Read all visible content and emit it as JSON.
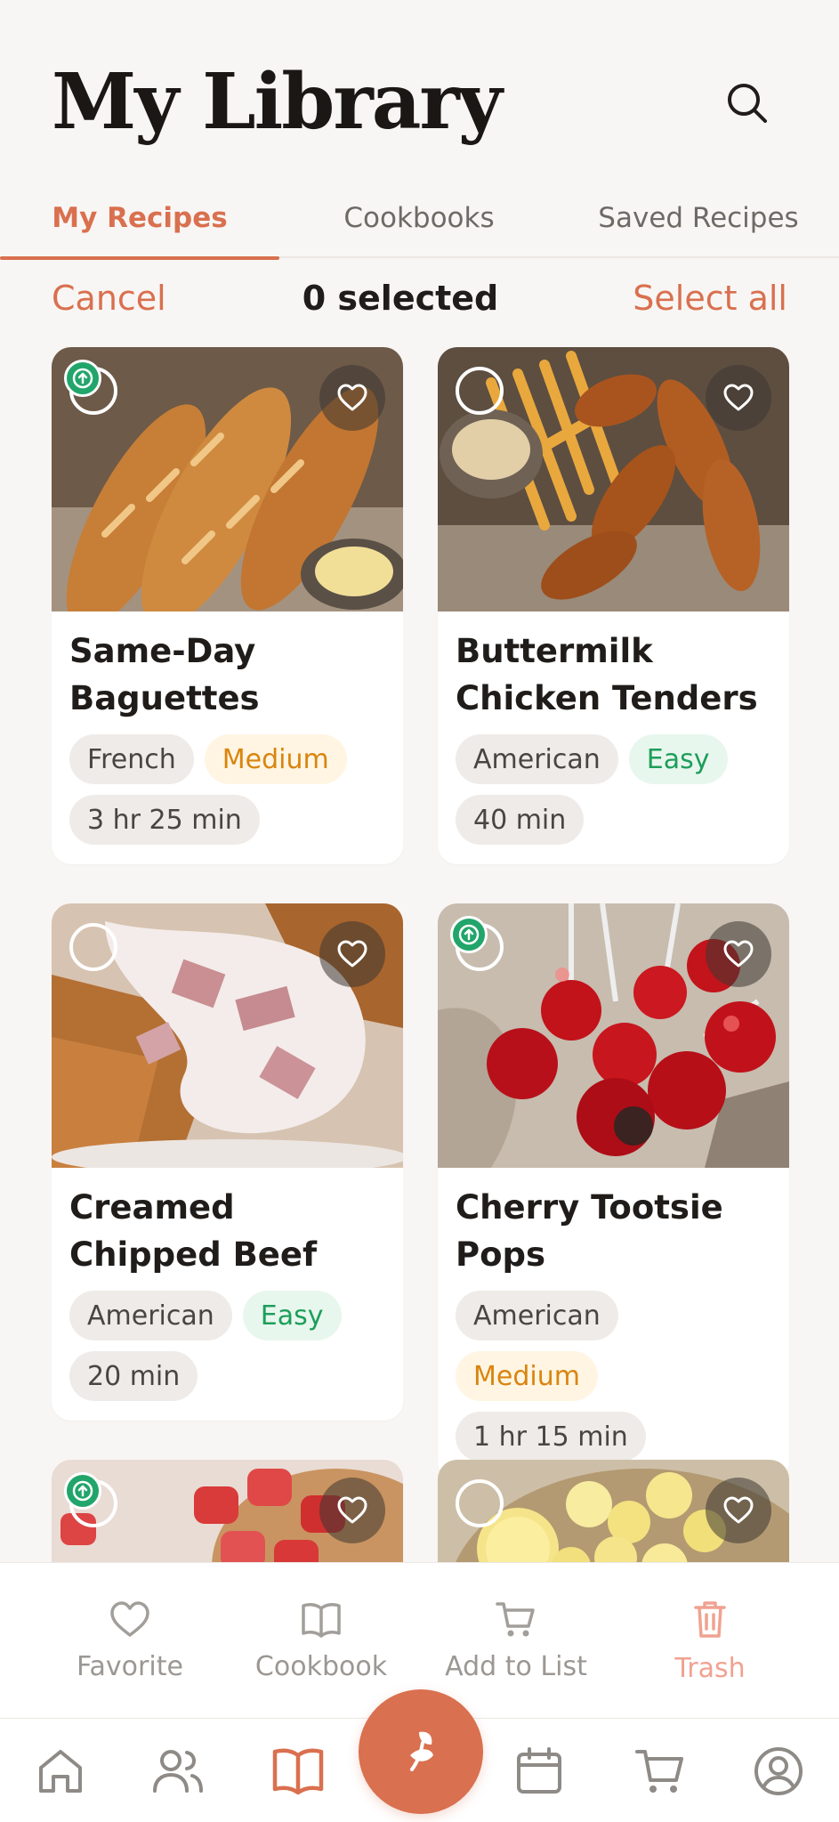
{
  "header": {
    "title": "My Library",
    "search_icon": "search-icon"
  },
  "tabs": [
    {
      "label": "My Recipes",
      "active": true
    },
    {
      "label": "Cookbooks",
      "active": false
    },
    {
      "label": "Saved Recipes",
      "active": false
    }
  ],
  "selection": {
    "cancel_label": "Cancel",
    "count_label": "0 selected",
    "select_all_label": "Select all"
  },
  "recipes": [
    {
      "title": "Same-Day Baguettes",
      "tags": [
        "French",
        "Medium"
      ],
      "time": "3 hr 25 min",
      "synced": true,
      "image": "baguettes-image"
    },
    {
      "title": "Buttermilk Chicken Tenders",
      "tags": [
        "American",
        "Easy"
      ],
      "time": "40 min",
      "synced": false,
      "image": "chicken-tenders-image"
    },
    {
      "title": "Creamed Chipped Beef on…",
      "tags": [
        "American",
        "Easy"
      ],
      "time": "20 min",
      "synced": false,
      "image": "chipped-beef-image"
    },
    {
      "title": "Cherry Tootsie Pops",
      "tags": [
        "American",
        "Medium"
      ],
      "time": "1 hr 15 min",
      "synced": true,
      "image": "cherry-pops-image"
    },
    {
      "title": "",
      "tags": [],
      "time": "",
      "synced": true,
      "image": "gummies-image"
    },
    {
      "title": "",
      "tags": [],
      "time": "",
      "synced": false,
      "image": "lemon-drops-image"
    }
  ],
  "actions": [
    {
      "label": "Favorite",
      "icon": "heart-icon"
    },
    {
      "label": "Cookbook",
      "icon": "book-icon"
    },
    {
      "label": "Add to List",
      "icon": "cart-icon"
    },
    {
      "label": "Trash",
      "icon": "trash-icon"
    }
  ],
  "nav": [
    {
      "icon": "home-icon"
    },
    {
      "icon": "community-icon"
    },
    {
      "icon": "library-icon",
      "active": true
    },
    {
      "icon": "add-recipe-icon"
    },
    {
      "icon": "calendar-icon"
    },
    {
      "icon": "shopping-cart-icon"
    },
    {
      "icon": "profile-icon"
    }
  ],
  "colors": {
    "accent": "#d9704f",
    "easy": "#1e9e5a",
    "medium": "#d9850f",
    "sync": "#21a56a"
  }
}
